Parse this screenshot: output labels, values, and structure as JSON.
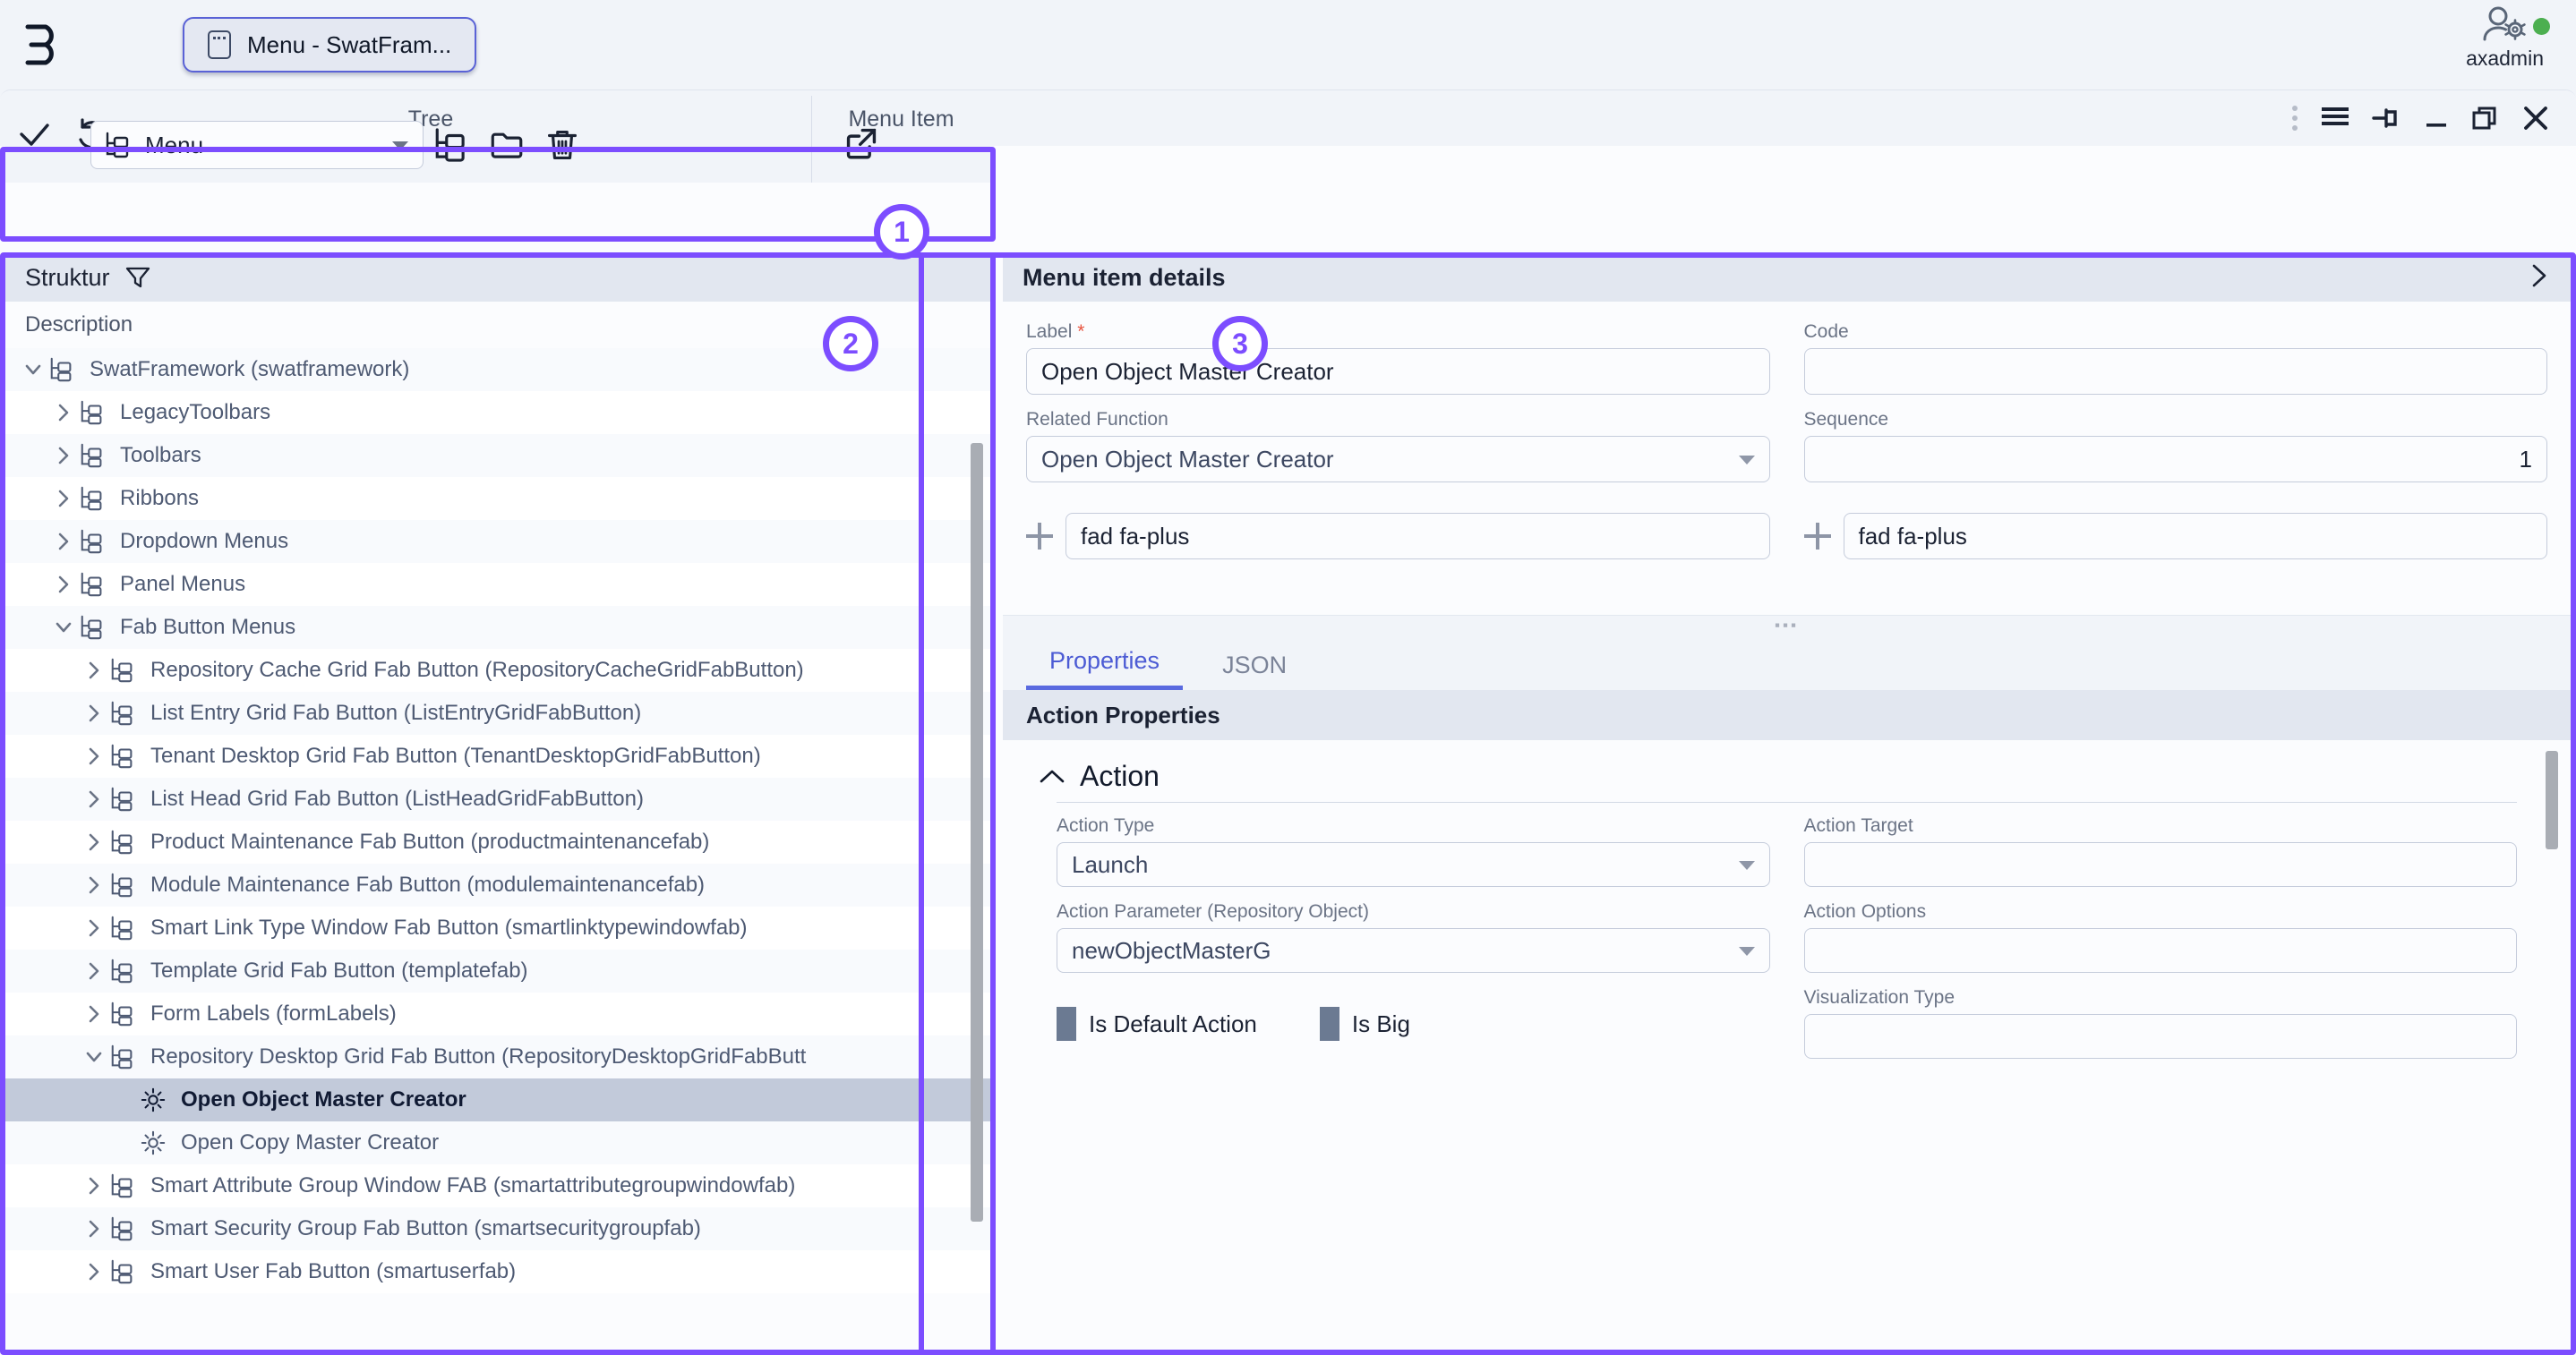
{
  "appbar": {
    "logo_icon": "epsilon-logo-icon",
    "task_tab": {
      "label": "Menu - SwatFram...",
      "icon": "window-icon"
    },
    "user": {
      "name": "axadmin",
      "avatar_icon": "user-gear-icon",
      "status": "online",
      "status_color": "#4caf50"
    }
  },
  "window": {
    "title": "Menu - SwatFramework",
    "icon": "window-icon",
    "controls": [
      {
        "name": "more-vertical-icon",
        "label": ""
      },
      {
        "name": "menu-icon",
        "label": ""
      },
      {
        "name": "pin-icon",
        "label": ""
      },
      {
        "name": "minimize-icon",
        "label": ""
      },
      {
        "name": "restore-icon",
        "label": ""
      },
      {
        "name": "close-icon",
        "label": ""
      }
    ]
  },
  "annotations": {
    "one": "1",
    "two": "2",
    "three": "3",
    "color": "#7c4dff"
  },
  "toolbar": {
    "confirm_icon": "check-icon",
    "undo_icon": "undo-icon",
    "tree_group_title": "Tree",
    "tree_select_value": "Menu",
    "tree_select_icon": "tree-icon",
    "add_node_icon": "add-tree-node-icon",
    "folder_icon": "folder-icon",
    "delete_icon": "trash-icon",
    "menuitem_group_title": "Menu Item",
    "open_external_icon": "open-external-icon"
  },
  "tree_panel": {
    "header_title": "Struktur",
    "filter_icon": "filter-icon",
    "column_header": "Description",
    "items": [
      {
        "label": "SwatFramework (swatframework)",
        "depth": 0,
        "state": "expanded",
        "icon": "tree-node-icon"
      },
      {
        "label": "LegacyToolbars",
        "depth": 1,
        "state": "collapsed",
        "icon": "tree-node-icon"
      },
      {
        "label": "Toolbars",
        "depth": 1,
        "state": "collapsed",
        "icon": "tree-node-icon"
      },
      {
        "label": "Ribbons",
        "depth": 1,
        "state": "collapsed",
        "icon": "tree-node-icon"
      },
      {
        "label": "Dropdown Menus",
        "depth": 1,
        "state": "collapsed",
        "icon": "tree-node-icon"
      },
      {
        "label": "Panel Menus",
        "depth": 1,
        "state": "collapsed",
        "icon": "tree-node-icon"
      },
      {
        "label": "Fab Button Menus",
        "depth": 1,
        "state": "expanded",
        "icon": "tree-node-icon"
      },
      {
        "label": "Repository Cache Grid Fab Button (RepositoryCacheGridFabButton)",
        "depth": 2,
        "state": "collapsed",
        "icon": "tree-node-icon"
      },
      {
        "label": "List Entry Grid Fab Button (ListEntryGridFabButton)",
        "depth": 2,
        "state": "collapsed",
        "icon": "tree-node-icon"
      },
      {
        "label": "Tenant Desktop Grid Fab Button (TenantDesktopGridFabButton)",
        "depth": 2,
        "state": "collapsed",
        "icon": "tree-node-icon"
      },
      {
        "label": "List Head Grid Fab Button (ListHeadGridFabButton)",
        "depth": 2,
        "state": "collapsed",
        "icon": "tree-node-icon"
      },
      {
        "label": "Product Maintenance Fab Button (productmaintenancefab)",
        "depth": 2,
        "state": "collapsed",
        "icon": "tree-node-icon"
      },
      {
        "label": "Module Maintenance Fab Button (modulemaintenancefab)",
        "depth": 2,
        "state": "collapsed",
        "icon": "tree-node-icon"
      },
      {
        "label": "Smart Link Type Window Fab Button (smartlinktypewindowfab)",
        "depth": 2,
        "state": "collapsed",
        "icon": "tree-node-icon"
      },
      {
        "label": "Template Grid Fab Button (templatefab)",
        "depth": 2,
        "state": "collapsed",
        "icon": "tree-node-icon"
      },
      {
        "label": "Form Labels (formLabels)",
        "depth": 2,
        "state": "collapsed",
        "icon": "tree-node-icon"
      },
      {
        "label": "Repository Desktop Grid Fab Button (RepositoryDesktopGridFabButt",
        "depth": 2,
        "state": "expanded",
        "icon": "tree-node-icon"
      },
      {
        "label": "Open Object Master Creator",
        "depth": 3,
        "state": "leaf",
        "icon": "gear-icon",
        "selected": true
      },
      {
        "label": "Open Copy Master Creator",
        "depth": 3,
        "state": "leaf",
        "icon": "gear-icon"
      },
      {
        "label": "Smart Attribute Group Window FAB (smartattributegroupwindowfab)",
        "depth": 2,
        "state": "collapsed",
        "icon": "tree-node-icon"
      },
      {
        "label": "Smart Security Group Fab Button (smartsecuritygroupfab)",
        "depth": 2,
        "state": "collapsed",
        "icon": "tree-node-icon"
      },
      {
        "label": "Smart User Fab Button (smartuserfab)",
        "depth": 2,
        "state": "collapsed",
        "icon": "tree-node-icon"
      }
    ]
  },
  "detail_panel": {
    "header_title": "Menu item details",
    "collapse_icon": "chevron-right-icon",
    "fields": {
      "label": {
        "label": "Label",
        "required": "*",
        "value": "Open Object Master Creator"
      },
      "code": {
        "label": "Code",
        "value": ""
      },
      "related_function": {
        "label": "Related Function",
        "value": "Open Object Master Creator"
      },
      "sequence": {
        "label": "Sequence",
        "value": "1"
      },
      "icon_left": {
        "value": "fad fa-plus",
        "add_icon": "plus-icon"
      },
      "icon_right": {
        "value": "fad fa-plus",
        "add_icon": "plus-icon"
      }
    },
    "tabs": [
      {
        "label": "Properties",
        "active": true
      },
      {
        "label": "JSON",
        "active": false
      }
    ],
    "section_title": "Action Properties",
    "action_group": {
      "title": "Action",
      "collapse_icon": "chevron-up-icon",
      "action_type": {
        "label": "Action Type",
        "value": "Launch"
      },
      "action_target": {
        "label": "Action Target",
        "value": ""
      },
      "action_parameter": {
        "label": "Action Parameter (Repository Object)",
        "value": "newObjectMasterG"
      },
      "action_options": {
        "label": "Action Options",
        "value": ""
      },
      "is_default_action": {
        "label": "Is Default Action",
        "checked": true
      },
      "is_big": {
        "label": "Is Big",
        "checked": true
      },
      "visualization_type": {
        "label": "Visualization Type",
        "value": ""
      }
    }
  }
}
